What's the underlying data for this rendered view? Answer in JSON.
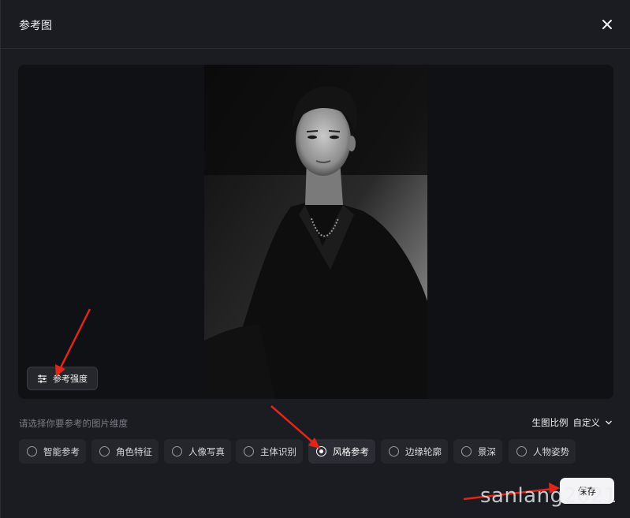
{
  "dialog": {
    "title": "参考图",
    "close_icon": "close-icon"
  },
  "preview": {
    "strength_button_label": "参考强度",
    "strength_icon": "sliders-icon"
  },
  "options": {
    "hint": "请选择你要参考的图片维度",
    "ratio_label": "生图比例",
    "ratio_value": "自定义",
    "items": [
      {
        "label": "智能参考",
        "selected": false
      },
      {
        "label": "角色特征",
        "selected": false
      },
      {
        "label": "人像写真",
        "selected": false
      },
      {
        "label": "主体识别",
        "selected": false
      },
      {
        "label": "风格参考",
        "selected": true
      },
      {
        "label": "边缘轮廓",
        "selected": false
      },
      {
        "label": "景深",
        "selected": false
      },
      {
        "label": "人物姿势",
        "selected": false
      }
    ]
  },
  "footer": {
    "save_label": "保存"
  },
  "watermark": "sanlang2021",
  "colors": {
    "modal_bg": "#1b1c21",
    "annotation_arrow": "#e0261b",
    "save_bg": "#f4f4f6"
  }
}
